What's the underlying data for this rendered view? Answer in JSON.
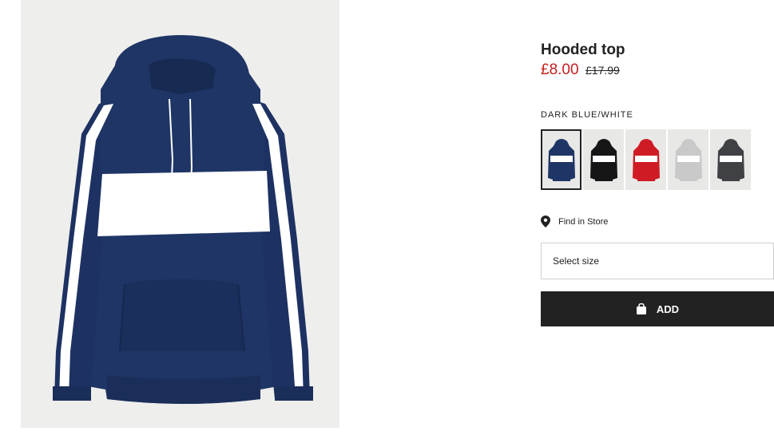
{
  "product": {
    "title": "Hooded top",
    "price_current": "£8.00",
    "price_original": "£17.99",
    "color_name": "DARK BLUE/WHITE",
    "image_icon": "navy-hoodie-photo"
  },
  "swatches": [
    {
      "name": "dark-blue-white",
      "body": "#1f3566",
      "stripe": "#ffffff",
      "selected": true
    },
    {
      "name": "black-white",
      "body": "#161616",
      "stripe": "#ffffff",
      "selected": false
    },
    {
      "name": "red-white",
      "body": "#cf1c24",
      "stripe": "#ffffff",
      "selected": false
    },
    {
      "name": "grey-white",
      "body": "#c9c9c9",
      "stripe": "#ffffff",
      "selected": false
    },
    {
      "name": "dark-grey-white",
      "body": "#3f4144",
      "stripe": "#ffffff",
      "selected": false
    }
  ],
  "find_store": {
    "label": "Find in Store",
    "icon": "map-pin-icon"
  },
  "size_select": {
    "placeholder": "Select size"
  },
  "add_button": {
    "label": "ADD",
    "icon": "shopping-bag-icon"
  },
  "colors": {
    "sale_price": "#c6201f",
    "button_bg": "#222222",
    "hoodie_navy": "#1f3566"
  }
}
